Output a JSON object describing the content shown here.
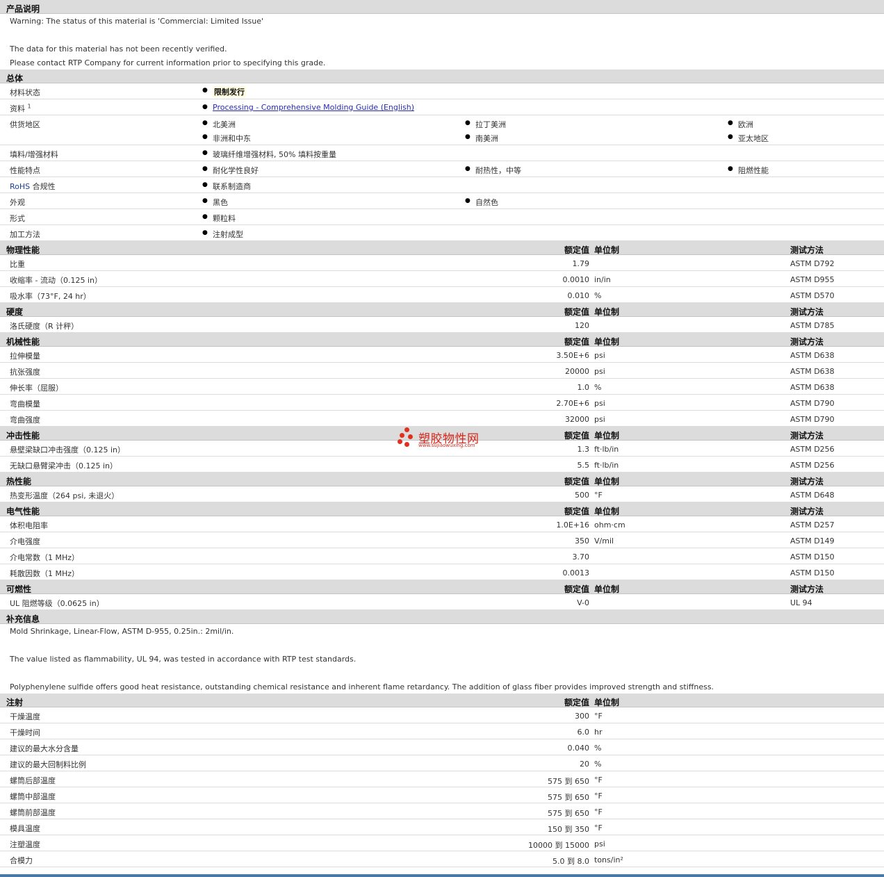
{
  "header_cols": {
    "value": "额定值",
    "unit": "单位制",
    "method": "测试方法"
  },
  "description": {
    "title": "产品说明",
    "lines": [
      "Warning: The status of this material is 'Commercial: Limited Issue'",
      "",
      "The data for this material has not been recently verified.",
      "Please contact RTP Company for current information prior to specifying this grade."
    ]
  },
  "general": {
    "title": "总体",
    "status_label": "材料状态",
    "status_value": "限制发行",
    "docs_label": "资料",
    "docs_sup": "1",
    "docs_link": "Processing - Comprehensive Molding Guide (English)",
    "region_label": "供货地区",
    "regions": [
      "北美洲",
      "拉丁美洲",
      "欧洲",
      "非洲和中东",
      "南美洲",
      "亚太地区"
    ],
    "filler_label": "填料/增强材料",
    "filler_value": "玻璃纤维增强材料, 50% 填料按重量",
    "feature_label": "性能特点",
    "features": [
      "耐化学性良好",
      "耐热性，中等",
      "阻燃性能"
    ],
    "rohs_label_a": "RoHS",
    "rohs_label_b": " 合规性",
    "rohs_value": "联系制造商",
    "appearance_label": "外观",
    "appearances": [
      "黑色",
      "自然色"
    ],
    "form_label": "形式",
    "form_value": "颗粒料",
    "method_label": "加工方法",
    "method_value": "注射成型"
  },
  "sections": [
    {
      "title": "物理性能",
      "show_method": true,
      "rows": [
        {
          "name": "比重",
          "value": "1.79",
          "unit": "",
          "method": "ASTM D792"
        },
        {
          "name": "收缩率 - 流动（0.125 in）",
          "value": "0.0010",
          "unit": "in/in",
          "method": "ASTM D955"
        },
        {
          "name": "吸水率（73°F, 24 hr）",
          "value": "0.010",
          "unit": "%",
          "method": "ASTM D570"
        }
      ]
    },
    {
      "title": "硬度",
      "show_method": true,
      "rows": [
        {
          "name": "洛氏硬度（R 计秤）",
          "value": "120",
          "unit": "",
          "method": "ASTM D785"
        }
      ]
    },
    {
      "title": "机械性能",
      "show_method": true,
      "rows": [
        {
          "name": "拉伸模量",
          "value": "3.50E+6",
          "unit": "psi",
          "method": "ASTM D638"
        },
        {
          "name": "抗张强度",
          "value": "20000",
          "unit": "psi",
          "method": "ASTM D638"
        },
        {
          "name": "伸长率（屈服）",
          "value": "1.0",
          "unit": "%",
          "method": "ASTM D638"
        },
        {
          "name": "弯曲模量",
          "value": "2.70E+6",
          "unit": "psi",
          "method": "ASTM D790"
        },
        {
          "name": "弯曲强度",
          "value": "32000",
          "unit": "psi",
          "method": "ASTM D790"
        }
      ]
    },
    {
      "title": "冲击性能",
      "show_method": true,
      "rows": [
        {
          "name": "悬壁梁缺口冲击强度（0.125 in）",
          "value": "1.3",
          "unit": "ft·lb/in",
          "method": "ASTM D256"
        },
        {
          "name": "无缺口悬臂梁冲击（0.125 in）",
          "value": "5.5",
          "unit": "ft·lb/in",
          "method": "ASTM D256"
        }
      ]
    },
    {
      "title": "热性能",
      "show_method": true,
      "rows": [
        {
          "name": "热变形温度（264 psi, 未退火）",
          "value": "500",
          "unit": "°F",
          "method": "ASTM D648"
        }
      ]
    },
    {
      "title": "电气性能",
      "show_method": true,
      "rows": [
        {
          "name": "体积电阻率",
          "value": "1.0E+16",
          "unit": "ohm·cm",
          "method": "ASTM D257"
        },
        {
          "name": "介电强度",
          "value": "350",
          "unit": "V/mil",
          "method": "ASTM D149"
        },
        {
          "name": "介电常数（1 MHz）",
          "value": "3.70",
          "unit": "",
          "method": "ASTM D150"
        },
        {
          "name": "耗散因数（1 MHz）",
          "value": "0.0013",
          "unit": "",
          "method": "ASTM D150"
        }
      ]
    },
    {
      "title": "可燃性",
      "show_method": true,
      "rows": [
        {
          "name": "UL 阻燃等级（0.0625 in）",
          "value": "V-0",
          "unit": "",
          "method": "UL 94"
        }
      ]
    }
  ],
  "supplement": {
    "title": "补充信息",
    "lines": [
      "Mold Shrinkage, Linear-Flow, ASTM D-955, 0.25in.: 2mil/in.",
      "",
      "The value listed as flammability, UL 94, was tested in accordance with RTP test standards.",
      "",
      "Polyphenylene sulfide offers good heat resistance, outstanding chemical resistance and inherent flame retardancy. The addition of glass fiber provides improved strength and stiffness."
    ]
  },
  "injection": {
    "title": "注射",
    "rows": [
      {
        "name": "干燥温度",
        "value": "300",
        "unit": "°F"
      },
      {
        "name": "干燥时间",
        "value": "6.0",
        "unit": "hr"
      },
      {
        "name": "建议的最大水分含量",
        "value": "0.040",
        "unit": "%"
      },
      {
        "name": "建议的最大回制料比例",
        "value": "20",
        "unit": "%"
      },
      {
        "name": "螺筒后部温度",
        "value": "575 到 650",
        "unit": "°F"
      },
      {
        "name": "螺筒中部温度",
        "value": "575 到 650",
        "unit": "°F"
      },
      {
        "name": "螺筒前部温度",
        "value": "575 到 650",
        "unit": "°F"
      },
      {
        "name": "模具温度",
        "value": "150 到 350",
        "unit": "°F"
      },
      {
        "name": "注塑温度",
        "value": "10000 到 15000",
        "unit": "psi"
      },
      {
        "name": "合模力",
        "value": "5.0 到 8.0",
        "unit": "tons/in²"
      }
    ]
  },
  "watermark": {
    "text": "塑胶物性网",
    "url": "www.sujiaowuxing.com"
  },
  "colors": {
    "header_bg": "#dcdcdc",
    "link": "#2a2ab0",
    "watermark": "#d8281c",
    "bottom_bar": "#4a79a8"
  }
}
